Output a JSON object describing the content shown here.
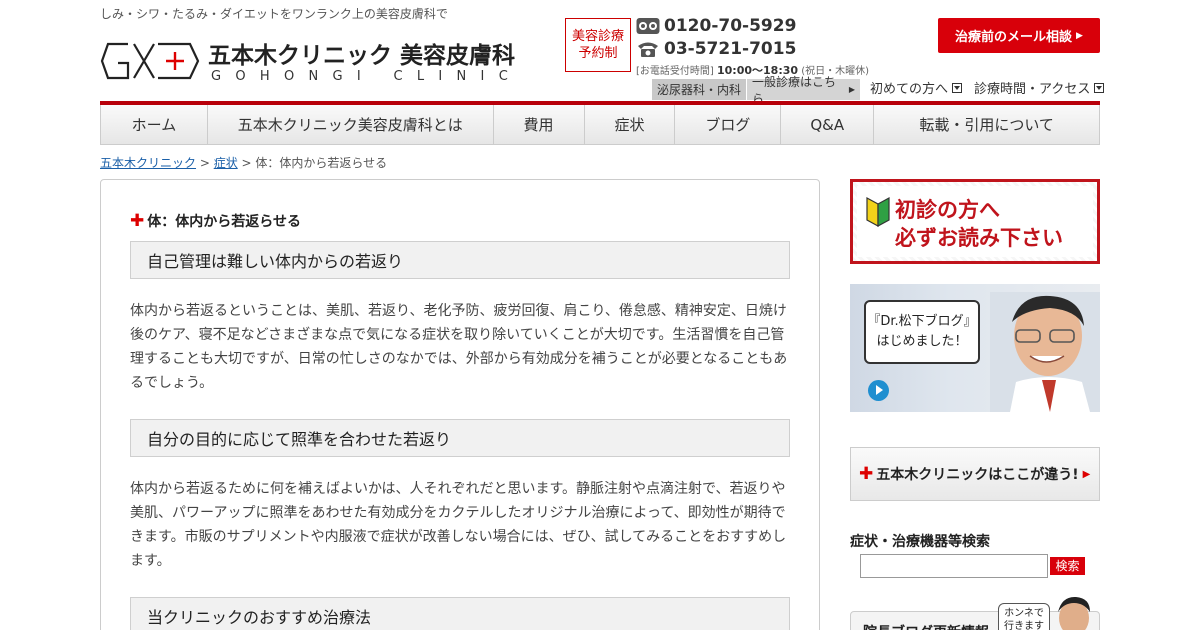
{
  "header": {
    "tagline": "しみ・シワ・たるみ・ダイエットをワンランク上の美容皮膚科で",
    "clinic_name": "五本木クリニック 美容皮膚科",
    "clinic_roman": "GOHONGI CLINIC",
    "reserve_label": "美容診療予約制",
    "phone_free": "0120-70-5929",
    "phone_tel": "03-5721-7015",
    "hours_label": "[お電話受付時間]",
    "hours_time": "10:00～18:30",
    "hours_note": "(祝日・木曜休)",
    "mail_button": "治療前のメール相談",
    "tab_urology": "泌尿器科・内科",
    "tab_general": "一般診療はこちら",
    "link_first": "初めての方へ",
    "link_hours": "診療時間・アクセス"
  },
  "nav": [
    "ホーム",
    "五本木クリニック美容皮膚科とは",
    "費用",
    "症状",
    "ブログ",
    "Q&A",
    "転載・引用について"
  ],
  "breadcrumb": {
    "home": "五本木クリニック",
    "sep1": " > ",
    "symptoms": "症状",
    "current": " > 体：体内から若返らせる"
  },
  "main": {
    "title": "体：体内から若返らせる",
    "sections": [
      {
        "heading": "自己管理は難しい体内からの若返り",
        "body": "体内から若返るということは、美肌、若返り、老化予防、疲労回復、肩こり、倦怠感、精神安定、日焼け後のケア、寝不足などさまざまな点で気になる症状を取り除いていくことが大切です。生活習慣を自己管理することも大切ですが、日常の忙しさのなかでは、外部から有効成分を補うことが必要となることもあるでしょう。"
      },
      {
        "heading": "自分の目的に応じて照準を合わせた若返り",
        "body": "体内から若返るために何を補えばよいかは、人それぞれだと思います。静脈注射や点滴注射で、若返りや美肌、パワーアップに照準をあわせた有効成分をカクテルしたオリジナル治療によって、即効性が期待できます。市販のサプリメントや内服液で症状が改善しない場合には、ぜひ、試してみることをおすすめします。"
      },
      {
        "heading": "当クリニックのおすすめ治療法"
      }
    ]
  },
  "sidebar": {
    "first_visit_line1": "初診の方へ",
    "first_visit_line2": "必ずお読み下さい",
    "blog_line1": "『Dr.松下ブログ』",
    "blog_line2": "はじめました！",
    "difference": "五本木クリニックはここが違う!",
    "search_title": "症状・治療機器等検索",
    "search_value": "",
    "search_button": "検索",
    "bottom_banner": "院長ブログ更新情報",
    "honne_line1": "ホンネで",
    "honne_line2": "行きます"
  },
  "colors": {
    "accent_red": "#d8000a",
    "link_blue": "#1a5fa8"
  }
}
